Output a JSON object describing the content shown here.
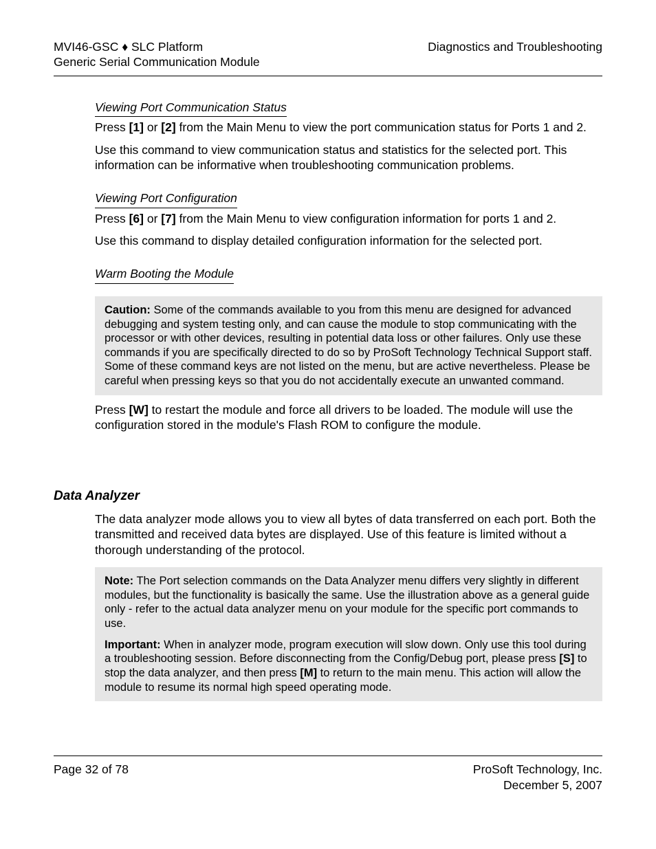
{
  "header": {
    "left_line1_a": "MVI46-GSC ",
    "left_line1_b": " SLC Platform",
    "left_line2": "Generic Serial Communication Module",
    "right": "Diagnostics and Troubleshooting"
  },
  "sections": {
    "commstatus": {
      "title": "Viewing Port Communication Status",
      "p1_a": "Press ",
      "p1_b": "[1]",
      "p1_c": " or ",
      "p1_d": "[2]",
      "p1_e": " from the Main Menu to view the port communication status for Ports 1 and 2.",
      "p2": "Use this command to view communication status and statistics for the selected port. This information can be informative when troubleshooting communication problems."
    },
    "portcfg": {
      "title": "Viewing Port Configuration",
      "p1_a": "Press ",
      "p1_b": "[6]",
      "p1_c": " or ",
      "p1_d": "[7]",
      "p1_e": " from the Main Menu to view configuration information for ports 1 and 2.",
      "p2": "Use this command to display detailed configuration information for the selected port."
    },
    "warmboot": {
      "title": "Warm Booting the Module",
      "caution_label": "Caution:",
      "caution_body": " Some of the commands available to you from this menu are designed for advanced debugging and system testing only, and can cause the module to stop communicating with the processor or with other devices, resulting in potential data loss or other failures. Only use these commands if you are specifically directed to do so by ProSoft Technology Technical Support staff. Some of these command keys are not listed on the menu, but are active nevertheless. Please be careful when pressing keys so that you do not accidentally execute an unwanted command.",
      "p1_a": "Press ",
      "p1_b": "[W]",
      "p1_c": " to restart the module and force all drivers to be loaded. The module will use the configuration stored in the module's Flash ROM to configure the module."
    },
    "analyzer": {
      "title": "Data Analyzer",
      "p1": "The data analyzer mode allows you to view all bytes of data transferred on each port. Both the transmitted and received data bytes are displayed. Use of this feature is limited without a thorough understanding of the protocol.",
      "note_label": "Note:",
      "note_body": " The Port selection commands on the Data Analyzer menu differs very slightly in different modules, but the functionality is basically the same. Use the illustration above as a general guide only - refer to the actual data analyzer menu on your module for the specific port commands to use.",
      "imp_label": "Important:",
      "imp_a": " When in analyzer mode, program execution will slow down. Only use this tool during a troubleshooting session. Before disconnecting from the Config/Debug port, please press ",
      "imp_b": "[S]",
      "imp_c": " to stop the data analyzer, and then press ",
      "imp_d": "[M]",
      "imp_e": " to return to the main menu. This action will allow the module to resume its normal high speed operating mode."
    }
  },
  "footer": {
    "left": "Page 32 of 78",
    "right1": "ProSoft Technology, Inc.",
    "right2": "December 5, 2007"
  }
}
